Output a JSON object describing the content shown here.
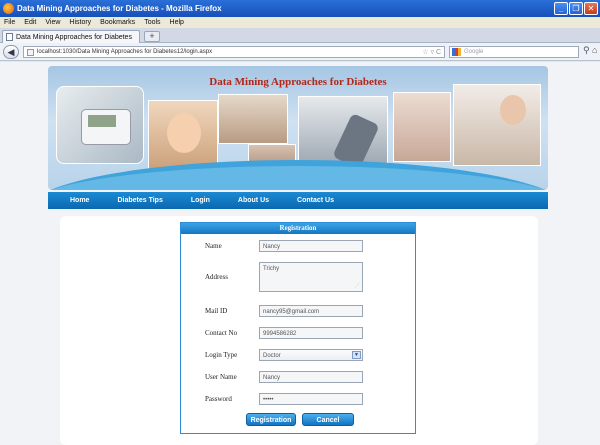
{
  "window": {
    "title": "Data Mining Approaches for Diabetes - Mozilla Firefox"
  },
  "menu": [
    "File",
    "Edit",
    "View",
    "History",
    "Bookmarks",
    "Tools",
    "Help"
  ],
  "tabs": [
    {
      "label": "Data Mining Approaches for Diabetes"
    }
  ],
  "newtab_label": "+",
  "address": {
    "url": "localhost:1030/Data Mining Approaches for Diabetes12/login.aspx"
  },
  "search": {
    "placeholder": "Google"
  },
  "site": {
    "banner_title": "Data Mining Approaches for Diabetes",
    "nav": [
      "Home",
      "Diabetes Tips",
      "Login",
      "About Us",
      "Contact Us"
    ],
    "active_nav": "Home"
  },
  "registration": {
    "heading": "Registration",
    "fields": {
      "name": {
        "label": "Name",
        "value": "Nancy"
      },
      "address": {
        "label": "Address",
        "value": "Trichy"
      },
      "mail": {
        "label": "Mail ID",
        "value": "nancy95@gmail.com"
      },
      "contact": {
        "label": "Contact No",
        "value": "9994586282"
      },
      "login_type": {
        "label": "Login Type",
        "value": "Doctor"
      },
      "username": {
        "label": "User Name",
        "value": "Nancy"
      },
      "password": {
        "label": "Password",
        "value": "•••••"
      }
    },
    "buttons": {
      "submit": "Registration",
      "cancel": "Cancel"
    }
  },
  "colors": {
    "accent": "#1576c2",
    "nav_bg": "#0b68b0",
    "title_red": "#b3261a"
  }
}
